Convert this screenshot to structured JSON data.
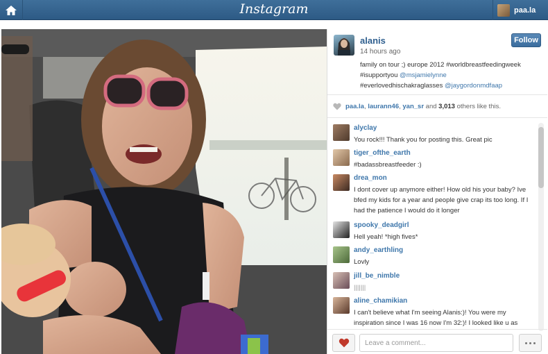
{
  "topbar": {
    "brand": "Instagram",
    "user": "paa.la",
    "icons": {
      "home": "home-icon"
    }
  },
  "post": {
    "author": "alanis",
    "time": "14 hours ago",
    "follow_label": "Follow",
    "caption": {
      "text": "family on tour ;) europe 2012 #worldbreastfeedingweek #isupportyou ",
      "mention1": "@msjamielynne",
      "line3": "#everlovedhischakraglasses ",
      "mention2": "@jaygordonmdfaap"
    }
  },
  "likes": {
    "users": [
      "paa.la",
      "laurann46",
      "yan_sr"
    ],
    "sep": ", ",
    "and": "and",
    "count": "3,013",
    "suffix": "others like this."
  },
  "comments": [
    {
      "user": "alyclay",
      "text": "You rock!!! Thank you for posting this. Great pic"
    },
    {
      "user": "tiger_ofthe_earth",
      "text": "#badassbreastfeeder :)"
    },
    {
      "user": "drea_mon",
      "text": "I dont cover up anymore either! How old his your baby? Ive bfed my kids for a year and people give crap its too long. If I had the patience I would do it longer"
    },
    {
      "user": "spooky_deadgirl",
      "text": "Hell yeah! *high fives*"
    },
    {
      "user": "andy_earthling",
      "text": "Lovly"
    },
    {
      "user": "jill_be_nimble",
      "text": "|||||||"
    },
    {
      "user": "aline_chamikian",
      "text": "I can't believe what I'm seeing Alanis:)! You were my inspiration since I was 16 now I'm 32:)! I looked like u as"
    }
  ],
  "footer": {
    "placeholder": "Leave a comment...",
    "like_icon": "heart-icon",
    "more_icon": "more-icon"
  },
  "colors": {
    "topbar": "#2d5a85",
    "link": "#3f77ab",
    "heart": "#c0392b"
  }
}
